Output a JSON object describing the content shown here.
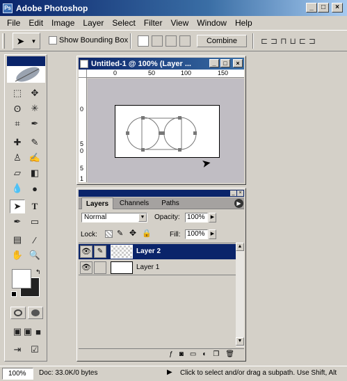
{
  "app": {
    "title": "Adobe Photoshop",
    "icon": "photoshop-icon"
  },
  "menu": [
    "File",
    "Edit",
    "Image",
    "Layer",
    "Select",
    "Filter",
    "View",
    "Window",
    "Help"
  ],
  "options": {
    "show_bounding_box": "Show Bounding Box",
    "combine": "Combine"
  },
  "document": {
    "title": "Untitled-1 @ 100% (Layer ...",
    "ruler_h": [
      "0",
      "50",
      "100",
      "150"
    ],
    "ruler_v": [
      "0",
      "5",
      "0",
      "5",
      "1"
    ]
  },
  "layers_panel": {
    "tabs": [
      "Layers",
      "Channels",
      "Paths"
    ],
    "blend_mode": "Normal",
    "opacity_label": "Opacity:",
    "opacity": "100%",
    "lock_label": "Lock:",
    "fill_label": "Fill:",
    "fill": "100%",
    "layers": [
      {
        "name": "Layer 2",
        "selected": true
      },
      {
        "name": "Layer 1",
        "selected": false
      }
    ]
  },
  "status": {
    "zoom": "100%",
    "doc": "Doc: 33.0K/0 bytes",
    "hint": "Click to select and/or drag a subpath.  Use Shift, Alt"
  },
  "colors": {
    "title_blue": "#0a246a",
    "selection_blue": "#0a246a",
    "chrome": "#d4d0c8"
  }
}
